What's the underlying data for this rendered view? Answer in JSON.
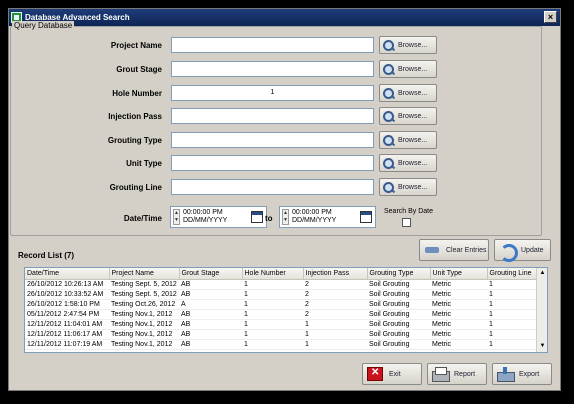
{
  "window": {
    "title": "Database Advanced Search",
    "close": "×"
  },
  "query": {
    "group_label": "Query Database",
    "fields": [
      {
        "label": "Project Name",
        "value": "",
        "browse": "Browse..."
      },
      {
        "label": "Grout Stage",
        "value": "",
        "browse": "Browse..."
      },
      {
        "label": "Hole Number",
        "value": "1",
        "browse": "Browse..."
      },
      {
        "label": "Injection Pass",
        "value": "",
        "browse": "Browse..."
      },
      {
        "label": "Grouting Type",
        "value": "",
        "browse": "Browse..."
      },
      {
        "label": "Unit Type",
        "value": "",
        "browse": "Browse..."
      },
      {
        "label": "Grouting Line",
        "value": "",
        "browse": "Browse..."
      }
    ],
    "date_label": "Date/Time",
    "from": {
      "time": "00:00:00 PM",
      "date": "DD/MM/YYYY"
    },
    "to_label": "to",
    "to": {
      "time": "00:00:00 PM",
      "date": "DD/MM/YYYY"
    },
    "search_by_date": "Search By Date"
  },
  "records": {
    "label": "Record List (7)",
    "clear_label": "Clear Entries",
    "update_label": "Update",
    "columns": [
      "Date/Time",
      "Project Name",
      "Grout Stage",
      "Hole Number",
      "Injection Pass",
      "Grouting Type",
      "Unit Type",
      "Grouting Line"
    ],
    "rows": [
      [
        "26/10/2012 10:26:13 AM",
        "Testing Sept. 5, 2012",
        "AB",
        "1",
        "2",
        "Soil Grouting",
        "Metric",
        "1"
      ],
      [
        "26/10/2012 10:33:52 AM",
        "Testing Sept. 5, 2012",
        "AB",
        "1",
        "2",
        "Soil Grouting",
        "Metric",
        "1"
      ],
      [
        "26/10/2012 1:58:10 PM",
        "Testing Oct.26, 2012",
        "A",
        "1",
        "2",
        "Soil Grouting",
        "Metric",
        "1"
      ],
      [
        "05/11/2012 2:47:54 PM",
        "Testing Nov.1, 2012",
        "AB",
        "1",
        "2",
        "Soil Grouting",
        "Metric",
        "1"
      ],
      [
        "12/11/2012 11:04:01 AM",
        "Testing Nov.1, 2012",
        "AB",
        "1",
        "1",
        "Soil Grouting",
        "Metric",
        "1"
      ],
      [
        "12/11/2012 11:06:17 AM",
        "Testing Nov.1, 2012",
        "AB",
        "1",
        "1",
        "Soil Grouting",
        "Metric",
        "1"
      ],
      [
        "12/11/2012 11:07:19 AM",
        "Testing Nov.1, 2012",
        "AB",
        "1",
        "1",
        "Soil Grouting",
        "Metric",
        "1"
      ]
    ]
  },
  "footer": {
    "exit": "Exit",
    "report": "Report",
    "export": "Export"
  }
}
